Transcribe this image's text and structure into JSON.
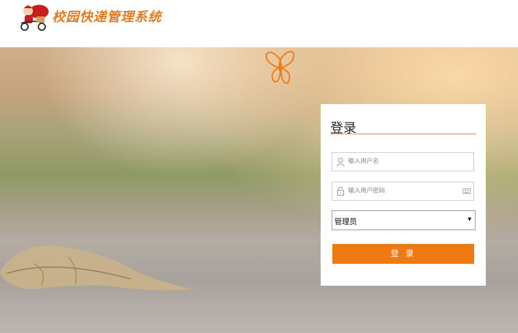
{
  "header": {
    "title": "校园快递管理系统",
    "logo_icon": "delivery-rider-logo"
  },
  "login": {
    "title": "登录",
    "username_placeholder": "输入用户名",
    "password_placeholder": "输入用户密码",
    "role_selected": "管理员",
    "submit_label": "登 录"
  },
  "colors": {
    "accent": "#ef7a12",
    "title_orange": "#e07b22"
  }
}
